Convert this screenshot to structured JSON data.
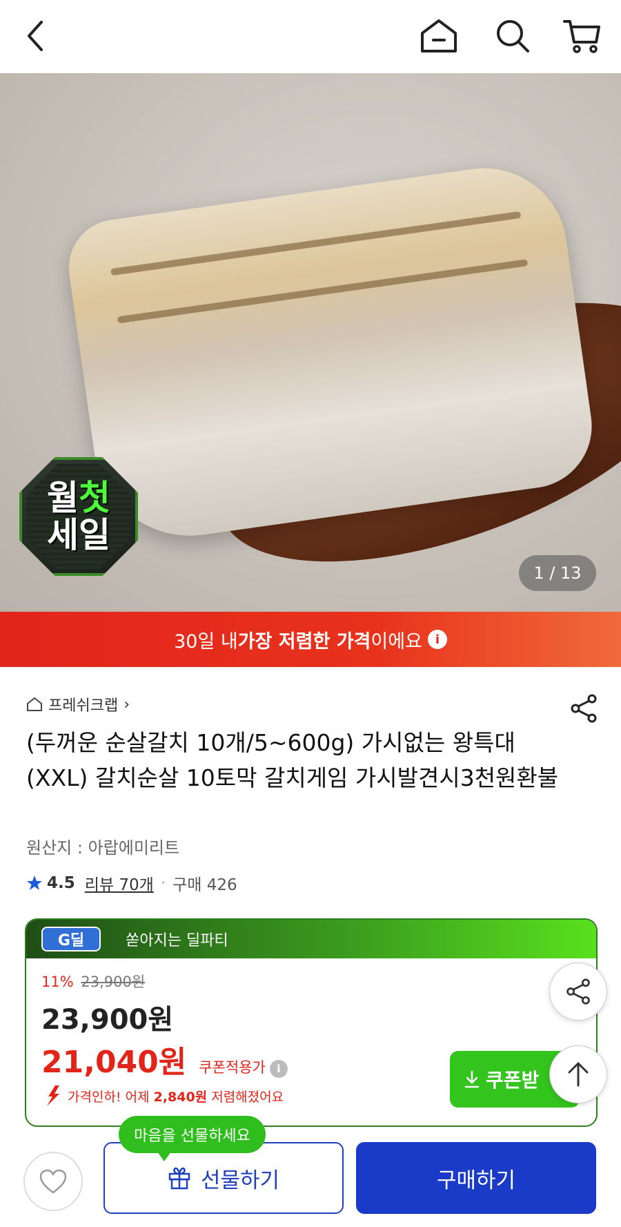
{
  "header": {
    "back_icon": "chevron-left-icon",
    "home_icon": "home-icon",
    "search_icon": "search-icon",
    "cart_icon": "cart-icon"
  },
  "gallery": {
    "badge_line1_a": "월",
    "badge_line1_b": "첫",
    "badge_line2": "세일",
    "counter": "1 / 13"
  },
  "price_banner": {
    "text_pre": "30일 내 ",
    "text_bold": "가장 저렴한 가격",
    "text_post": "이에요",
    "info_icon": "i"
  },
  "product": {
    "store_name": "프레쉬크랩",
    "store_arrow": "›",
    "title": "(두꺼운 순살갈치 10개/5~600g) 가시없는 왕특대(XXL) 갈치순살 10토막 갈치게임 가시발견시3천원환불",
    "origin": "원산지 : 아랍에미리트",
    "rating": "4.5",
    "review": "리뷰 70개",
    "separator": "·",
    "purchase": "구매 426"
  },
  "deal": {
    "logo": "G딜",
    "headline": "쏟아지는 딜파티",
    "discount_pct": "11%",
    "original_price": "23,900원",
    "price": "23,900원",
    "coupon_price": "21,040원",
    "coupon_label": "쿠폰적용가",
    "info_icon": "i",
    "drop_text_pre": "가격인하! 어제 ",
    "drop_amount": "2,840원",
    "drop_text_post": " 저렴해졌어요",
    "coupon_button": "쿠폰받"
  },
  "bottom": {
    "gift_tip": "마음을 선물하세요",
    "gift_button": "선물하기",
    "buy_button": "구매하기"
  },
  "colors": {
    "accent_red": "#e1251b",
    "deal_green": "#33c41d",
    "buy_blue": "#1a3bc7"
  }
}
